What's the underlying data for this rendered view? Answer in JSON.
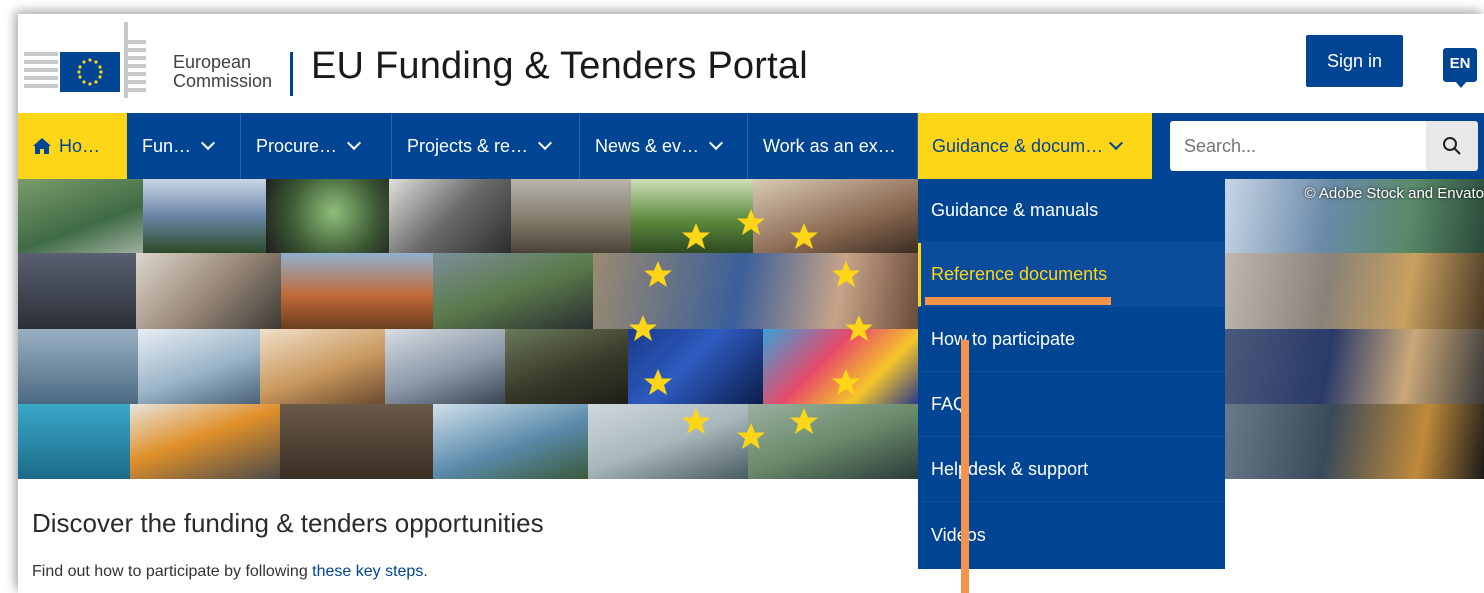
{
  "header": {
    "org_line1": "European",
    "org_line2": "Commission",
    "portal_title": "EU Funding & Tenders Portal",
    "signin_label": "Sign in",
    "language": "EN"
  },
  "nav": {
    "items": [
      {
        "label": "Ho…",
        "icon": "home-icon"
      },
      {
        "label": "Fun…"
      },
      {
        "label": "Procure…"
      },
      {
        "label": "Projects & re…"
      },
      {
        "label": "News & ev…"
      },
      {
        "label": "Work as an ex…"
      },
      {
        "label": "Guidance & docum…"
      }
    ],
    "search_placeholder": "Search..."
  },
  "banner": {
    "credit": "© Adobe Stock and Envato"
  },
  "dropdown": {
    "items": [
      {
        "label": "Guidance & manuals"
      },
      {
        "label": "Reference documents"
      },
      {
        "label": "How to participate"
      },
      {
        "label": "FAQ"
      },
      {
        "label": "Helpdesk & support"
      },
      {
        "label": "Videos"
      }
    ]
  },
  "content": {
    "title": "Discover the funding & tenders opportunities",
    "text_before": "Find out how to participate by following ",
    "link": "these key steps",
    "text_after": "."
  },
  "colors": {
    "brand_blue": "#004494",
    "accent_yellow": "#ffd617",
    "annotation_orange": "#f5934a"
  }
}
